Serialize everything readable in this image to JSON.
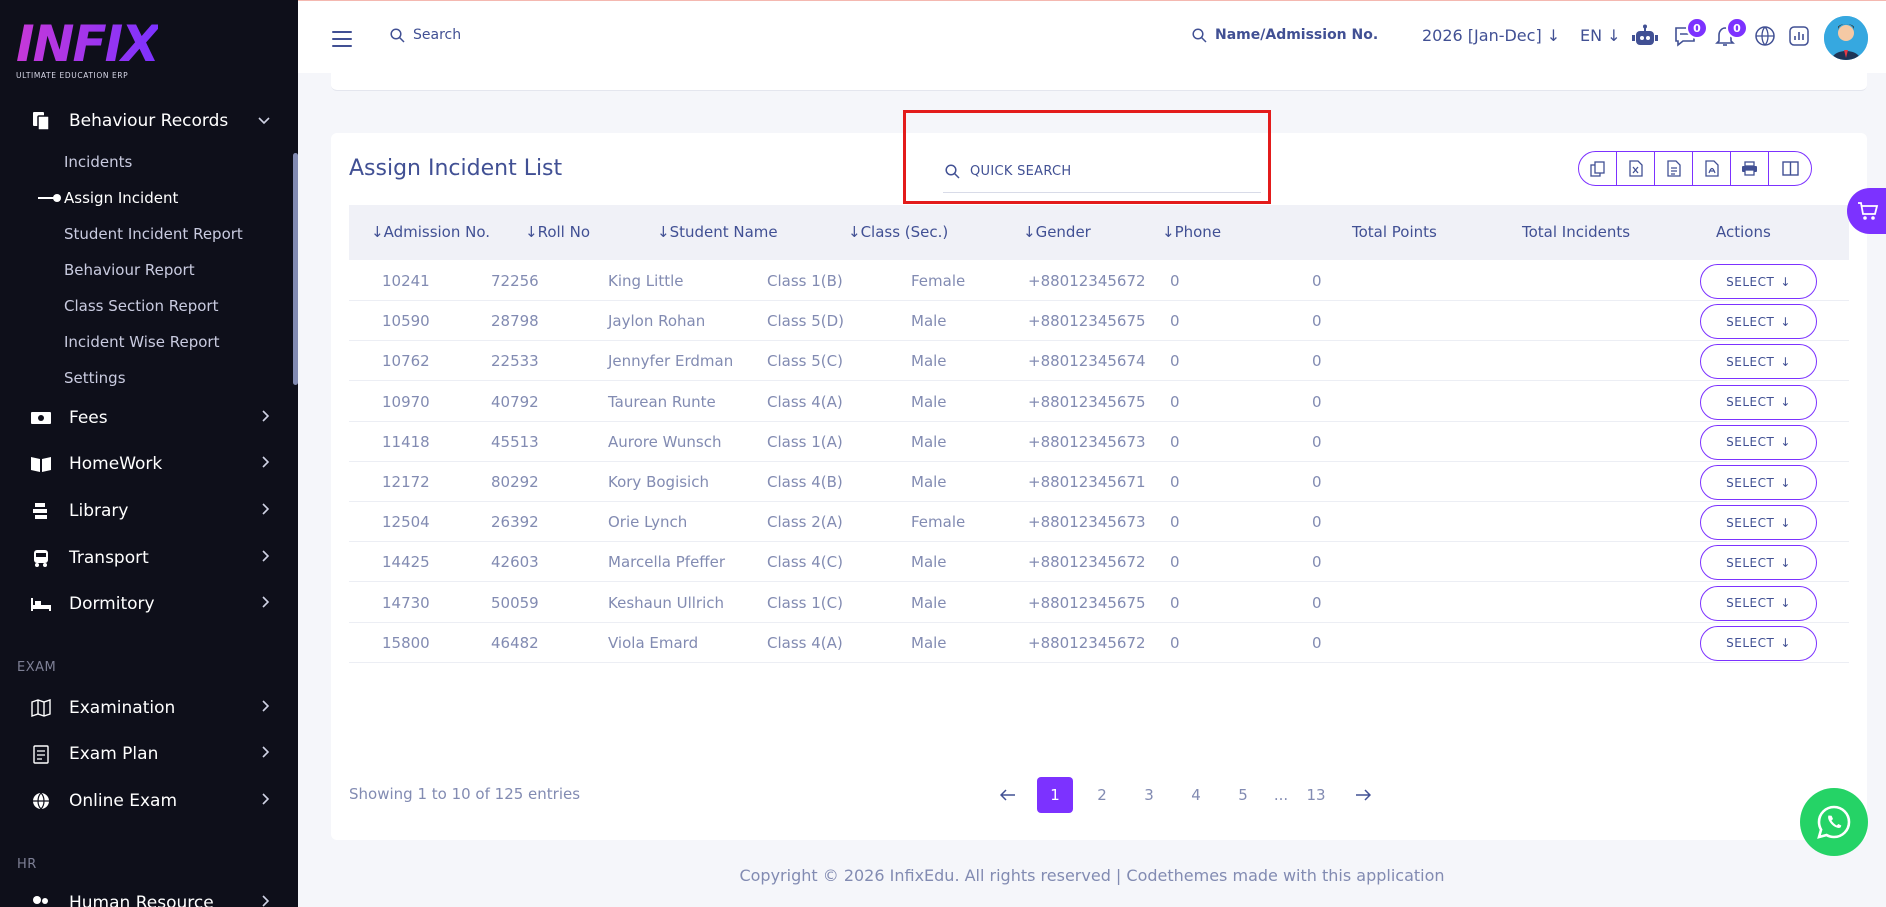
{
  "sidebar": {
    "logo_text": "INFIX",
    "logo_tagline": "ULTIMATE EDUCATION ERP",
    "behaviour": {
      "label": "Behaviour Records",
      "items": [
        "Incidents",
        "Assign Incident",
        "Student Incident Report",
        "Behaviour Report",
        "Class Section Report",
        "Incident Wise Report",
        "Settings"
      ],
      "active_index": 1
    },
    "menus_a": [
      {
        "label": "Fees",
        "icon": "money-icon"
      },
      {
        "label": "HomeWork",
        "icon": "book-icon"
      },
      {
        "label": "Library",
        "icon": "library-icon"
      },
      {
        "label": "Transport",
        "icon": "bus-icon"
      },
      {
        "label": "Dormitory",
        "icon": "bed-icon"
      }
    ],
    "section_exam": "EXAM",
    "menus_b": [
      {
        "label": "Examination",
        "icon": "map-icon"
      },
      {
        "label": "Exam Plan",
        "icon": "clipboard-icon"
      },
      {
        "label": "Online Exam",
        "icon": "globe-icon"
      }
    ],
    "section_hr": "HR",
    "menus_c": [
      {
        "label": "Human Resource",
        "icon": "people-icon"
      }
    ]
  },
  "topbar": {
    "search_label": "Search",
    "name_search_label": "Name/Admission No.",
    "session_label": "2026 [Jan-Dec]",
    "lang_label": "EN",
    "messages_count": "0",
    "notifications_count": "0"
  },
  "content": {
    "title": "Assign Incident List",
    "quick_search_placeholder": "QUICK SEARCH",
    "columns": [
      "Admission No.",
      "Roll No",
      "Student Name",
      "Class (Sec.)",
      "Gender",
      "Phone",
      "Total Points",
      "Total Incidents",
      "Actions"
    ],
    "rows": [
      [
        "10241",
        "72256",
        "King Little",
        "Class 1(B)",
        "Female",
        "+88012345672",
        "0",
        "0"
      ],
      [
        "10590",
        "28798",
        "Jaylon Rohan",
        "Class 5(D)",
        "Male",
        "+88012345675",
        "0",
        "0"
      ],
      [
        "10762",
        "22533",
        "Jennyfer Erdman",
        "Class 5(C)",
        "Male",
        "+88012345674",
        "0",
        "0"
      ],
      [
        "10970",
        "40792",
        "Taurean Runte",
        "Class 4(A)",
        "Male",
        "+88012345675",
        "0",
        "0"
      ],
      [
        "11418",
        "45513",
        "Aurore Wunsch",
        "Class 1(A)",
        "Male",
        "+88012345673",
        "0",
        "0"
      ],
      [
        "12172",
        "80292",
        "Kory Bogisich",
        "Class 4(B)",
        "Male",
        "+88012345671",
        "0",
        "0"
      ],
      [
        "12504",
        "26392",
        "Orie Lynch",
        "Class 2(A)",
        "Female",
        "+88012345673",
        "0",
        "0"
      ],
      [
        "14425",
        "42603",
        "Marcella Pfeffer",
        "Class 4(C)",
        "Male",
        "+88012345672",
        "0",
        "0"
      ],
      [
        "14730",
        "50059",
        "Keshaun Ullrich",
        "Class 1(C)",
        "Male",
        "+88012345675",
        "0",
        "0"
      ],
      [
        "15800",
        "46482",
        "Viola Emard",
        "Class 4(A)",
        "Male",
        "+88012345672",
        "0",
        "0"
      ]
    ],
    "action_label": "SELECT",
    "showing_text": "Showing 1 to 10 of 125 entries",
    "pages": [
      "1",
      "2",
      "3",
      "4",
      "5",
      "...",
      "13"
    ],
    "active_page": "1",
    "footer": "Copyright © 2026 InfixEdu. All rights reserved | Codethemes made with this application"
  },
  "colors": {
    "accent": "#7c32ff",
    "text_primary": "#415094",
    "text_muted": "#828bb2",
    "sidebar_bg": "#0e0f1a",
    "highlight_box": "#e31b1b",
    "whatsapp": "#25d366"
  }
}
